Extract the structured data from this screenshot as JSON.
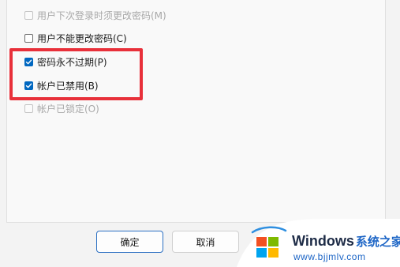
{
  "options": [
    {
      "label": "用户下次登录时须更改密码(M)",
      "checked": false,
      "disabled": true
    },
    {
      "label": "用户不能更改密码(C)",
      "checked": false,
      "disabled": false
    },
    {
      "label": "密码永不过期(P)",
      "checked": true,
      "disabled": false
    },
    {
      "label": "帐户已禁用(B)",
      "checked": true,
      "disabled": false
    },
    {
      "label": "帐户已锁定(O)",
      "checked": false,
      "disabled": true
    }
  ],
  "buttons": {
    "ok": "确定",
    "cancel": "取消"
  },
  "watermark": {
    "title": "Windows",
    "subtitle": "系统之家",
    "url": "www.bjjmlv.com"
  },
  "colors": {
    "accent": "#0067c0",
    "highlight": "#e8303a"
  }
}
